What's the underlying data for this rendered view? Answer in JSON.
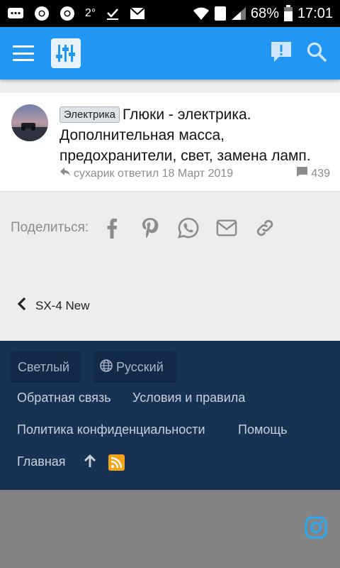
{
  "status_bar": {
    "temperature": "2°",
    "battery_percent": "68%",
    "time": "17:01",
    "sim_slot": "1"
  },
  "header": {
    "menu_icon": "hamburger-menu-icon",
    "logo_icon": "sliders-logo-icon",
    "alert_icon": "chat-alert-icon",
    "search_icon": "search-icon"
  },
  "thread": {
    "prefix": "Электрика",
    "title": "Глюки - электрика. Дополнительная масса, предохранители, свет, замена ламп.",
    "last_reply": "сухарик ответил 18 Март 2019",
    "reply_count": "439"
  },
  "share": {
    "label": "Поделиться:",
    "icons": [
      "facebook-icon",
      "pinterest-icon",
      "whatsapp-icon",
      "email-icon",
      "link-icon"
    ]
  },
  "back_link": {
    "label": "SX-4 New"
  },
  "footer": {
    "style_chip": "Светлый",
    "language_chip": "Русский",
    "links": {
      "feedback": "Обратная связь",
      "terms": "Условия и правила",
      "privacy": "Политика конфиденциальности",
      "help": "Помощь",
      "home": "Главная"
    }
  },
  "colors": {
    "accent": "#2196f3",
    "footer_bg": "#183254",
    "rss": "#f6a31a"
  }
}
